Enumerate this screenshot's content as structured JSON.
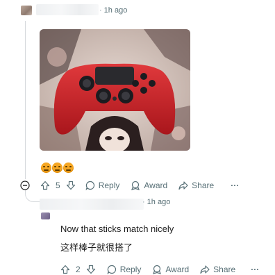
{
  "comment": {
    "time": "1h ago",
    "votes": "5",
    "actions": {
      "reply": "Reply",
      "award": "Award",
      "share": "Share",
      "more": "···"
    }
  },
  "reply": {
    "time": "1h ago",
    "lines": [
      "Now that sticks match nicely",
      "这样棒子就很搭了"
    ],
    "votes": "2",
    "actions": {
      "reply": "Reply",
      "award": "Award",
      "share": "Share",
      "more": "···"
    }
  },
  "colors": {
    "accent": "#576f76",
    "thread": "#d6d9dc",
    "text": "#1c1c1c"
  },
  "icons": [
    "upvote-icon",
    "downvote-icon",
    "reply-bubble-icon",
    "award-icon",
    "share-arrow-icon",
    "collapse-minus-icon",
    "more-dots-icon"
  ]
}
